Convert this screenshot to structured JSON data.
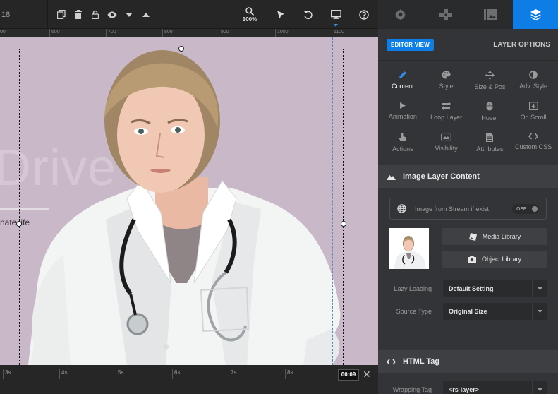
{
  "toolbar": {
    "slide_number": "18",
    "zoom_label": "100%"
  },
  "ruler": {
    "marks": [
      "00",
      "600",
      "700",
      "800",
      "900",
      "1000",
      "1100"
    ]
  },
  "canvas": {
    "bg_title": "Drive",
    "bg_subtitle": "nate life"
  },
  "timeline": {
    "marks": [
      "3s",
      "4s",
      "5s",
      "6s",
      "7s",
      "8s"
    ],
    "current_time": "00:09"
  },
  "panel": {
    "tabs": [
      "settings-icon",
      "navigation-icon",
      "slide-bg-icon",
      "layers-icon"
    ],
    "editor_view_label": "EDITOR VIEW",
    "layer_options_label": "LAYER OPTIONS",
    "options": [
      {
        "label": "Content",
        "icon": "pencil-icon"
      },
      {
        "label": "Style",
        "icon": "palette-icon"
      },
      {
        "label": "Size & Pos",
        "icon": "move-icon"
      },
      {
        "label": "Adv. Style",
        "icon": "contrast-icon"
      },
      {
        "label": "Animation",
        "icon": "play-icon"
      },
      {
        "label": "Loop Layer",
        "icon": "loop-icon"
      },
      {
        "label": "Hover",
        "icon": "mouse-icon"
      },
      {
        "label": "On Scroll",
        "icon": "scroll-icon"
      },
      {
        "label": "Actions",
        "icon": "pointer-icon"
      },
      {
        "label": "Visibility",
        "icon": "visibility-icon"
      },
      {
        "label": "Attributes",
        "icon": "file-icon"
      },
      {
        "label": "Custom CSS",
        "icon": "code-icon"
      }
    ],
    "image_section_title": "Image Layer Content",
    "stream_label": "Image from Stream if exist",
    "stream_toggle": "OFF",
    "media_library_label": "Media Library",
    "object_library_label": "Object Library",
    "lazy_loading_label": "Lazy Loading",
    "lazy_loading_value": "Default Setting",
    "source_type_label": "Source Type",
    "source_type_value": "Original Size",
    "html_tag_title": "HTML Tag",
    "wrapping_tag_label": "Wrapping Tag",
    "wrapping_tag_value": "<rs-layer>"
  }
}
